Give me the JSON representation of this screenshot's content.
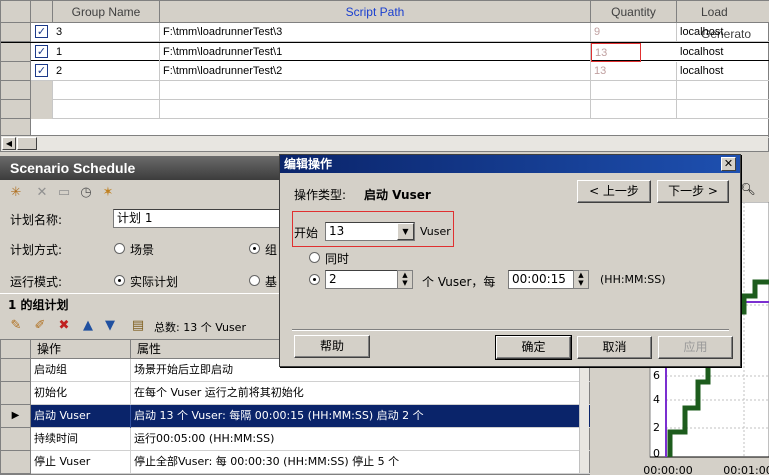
{
  "top_grid": {
    "headers": [
      "Group Name",
      "Script Path",
      "Quantity",
      "Load Generator"
    ],
    "header_visible": [
      "Group Name",
      "Script Path",
      "Quantity",
      "Load Generato"
    ],
    "rows": [
      {
        "checked": true,
        "group": "3",
        "path": "F:\\tmm\\loadrunnerTest\\3",
        "quantity": "9",
        "generator": "localhost"
      },
      {
        "checked": true,
        "group": "1",
        "path": "F:\\tmm\\loadrunnerTest\\1",
        "quantity": "13",
        "generator": "localhost"
      },
      {
        "checked": true,
        "group": "2",
        "path": "F:\\tmm\\loadrunnerTest\\2",
        "quantity": "13",
        "generator": "localhost"
      }
    ]
  },
  "schedule": {
    "title": "Scenario Schedule",
    "plan_name_label": "计划名称:",
    "plan_name_value": "计划 1",
    "plan_mode_label": "计划方式:",
    "plan_mode_options": [
      "场景",
      "组"
    ],
    "run_mode_label": "运行模式:",
    "run_mode_options": [
      "实际计划",
      "基"
    ],
    "group_plan_title": "1 的组计划",
    "total_label": "总数: 13 个 Vuser",
    "table_headers": [
      "操作",
      "属性"
    ],
    "table_rows": [
      {
        "action": "启动组",
        "property": "场景开始后立即启动"
      },
      {
        "action": "初始化",
        "property": "在每个 Vuser 运行之前将其初始化"
      },
      {
        "action": "启动 Vuser",
        "property": "启动 13 个 Vuser: 每隔 00:00:15 (HH:MM:SS) 启动 2 个"
      },
      {
        "action": "持续时间",
        "property": "运行00:05:00 (HH:MM:SS)"
      },
      {
        "action": "停止 Vuser",
        "property": "停止全部Vuser: 每 00:00:30 (HH:MM:SS) 停止 5 个"
      }
    ]
  },
  "chart": {
    "y_ticks": [
      "0",
      "2",
      "4",
      "6"
    ],
    "x_ticks": [
      "00:00:00",
      "00:01:00"
    ]
  },
  "dialog": {
    "title": "编辑操作",
    "op_type_label": "操作类型:",
    "op_type_value": "启动 Vuser",
    "prev_button": "< 上一步",
    "next_button": "下一步 >",
    "start_label": "开始",
    "start_value": "13",
    "vuser_label": "Vuser",
    "simultaneous_label": "同时",
    "every_count": "2",
    "every_label": "个 Vuser，每",
    "interval_value": "00:00:15",
    "interval_format": "(HH:MM:SS)",
    "help_button": "帮助",
    "ok_button": "确定",
    "cancel_button": "取消",
    "apply_button": "应用"
  }
}
